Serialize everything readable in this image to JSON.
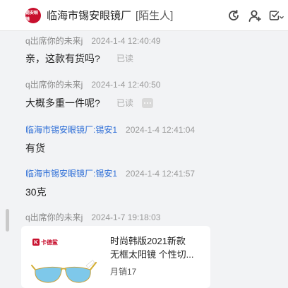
{
  "header": {
    "avatar_text": "锡安眼镜",
    "title": "临海市锡安眼镜厂",
    "tag": "[陌生人]",
    "icons": [
      "refresh-icon",
      "add-user-icon",
      "checkbox-dropdown-icon"
    ]
  },
  "messages": [
    {
      "sender": "q出席你的未来j",
      "time": "2024-1-4 12:40:49",
      "text": "亲，这款有货吗?",
      "status": "已读"
    },
    {
      "sender": "q出席你的未来j",
      "time": "2024-1-4 12:40:50",
      "text": "大概多重一件呢?",
      "status": "已读"
    },
    {
      "sender": "临海市锡安眼镜厂:锡安1",
      "time": "2024-1-4 12:41:04",
      "text": "有货"
    },
    {
      "sender": "临海市锡安眼镜厂:锡安1",
      "time": "2024-1-4 12:41:57",
      "text": "30克"
    },
    {
      "sender": "q出席你的未来j",
      "time": "2024-1-7 19:18:03"
    }
  ],
  "product_card": {
    "brand": "卡德鲨",
    "title_line1": "时尚韩版2021新款",
    "title_line2": "无框太阳镜 个性切...",
    "sales": "月销17"
  },
  "colors": {
    "shop_name": "#2b6cd6",
    "avatar": "#c8102e",
    "lens": "#7ec8ea"
  }
}
